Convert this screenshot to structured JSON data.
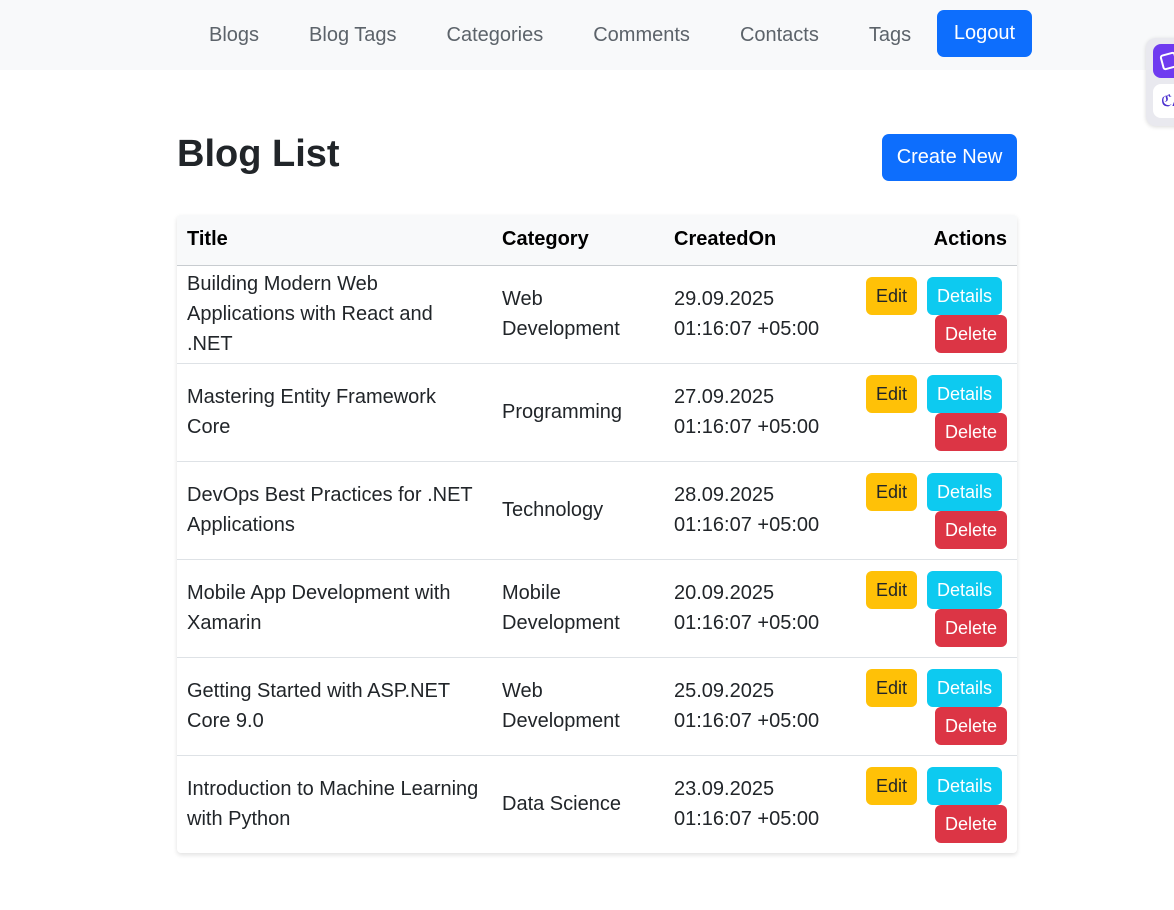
{
  "nav": {
    "links": [
      "Blogs",
      "Blog Tags",
      "Categories",
      "Comments",
      "Contacts",
      "Tags"
    ],
    "logout_label": "Logout"
  },
  "page": {
    "title": "Blog List",
    "create_label": "Create New"
  },
  "table": {
    "headers": {
      "title": "Title",
      "category": "Category",
      "created_on": "CreatedOn",
      "actions": "Actions"
    },
    "action_labels": {
      "edit": "Edit",
      "details": "Details",
      "delete": "Delete"
    },
    "rows": [
      {
        "title": "Building Modern Web Applications with React and .NET",
        "category": "Web Development",
        "created_on": "29.09.2025 01:16:07 +05:00"
      },
      {
        "title": "Mastering Entity Framework Core",
        "category": "Programming",
        "created_on": "27.09.2025 01:16:07 +05:00"
      },
      {
        "title": "DevOps Best Practices for .NET Applications",
        "category": "Technology",
        "created_on": "28.09.2025 01:16:07 +05:00"
      },
      {
        "title": "Mobile App Development with Xamarin",
        "category": "Mobile Development",
        "created_on": "20.09.2025 01:16:07 +05:00"
      },
      {
        "title": "Getting Started with ASP.NET Core 9.0",
        "category": "Web Development",
        "created_on": "25.09.2025 01:16:07 +05:00"
      },
      {
        "title": "Introduction to Machine Learning with Python",
        "category": "Data Science",
        "created_on": "23.09.2025 01:16:07 +05:00"
      }
    ]
  },
  "extension": {
    "icons": [
      "translate-extension-icon",
      "language-extension-icon"
    ],
    "glyph": "ℭA"
  },
  "colors": {
    "primary": "#0d6efd",
    "warning": "#ffc107",
    "info": "#0dcaf0",
    "danger": "#dc3545",
    "navbar_bg": "#f8f9fa"
  }
}
